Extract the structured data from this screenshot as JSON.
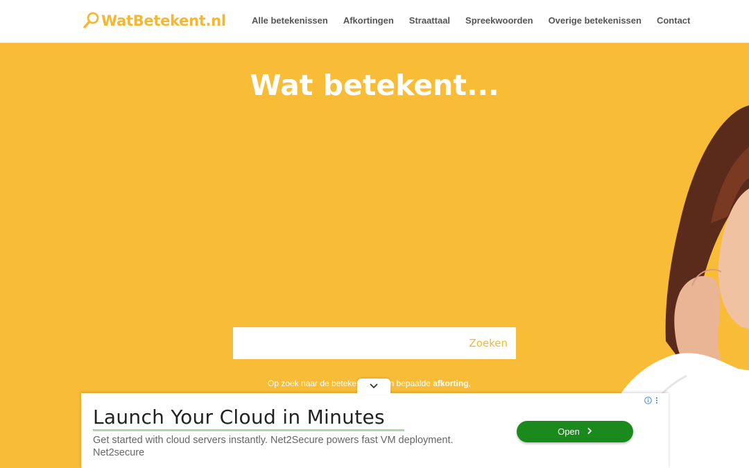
{
  "header": {
    "logo_text": "WatBetekent.nl",
    "nav": [
      {
        "label": "Alle betekenissen"
      },
      {
        "label": "Afkortingen"
      },
      {
        "label": "Straattaal"
      },
      {
        "label": "Spreekwoorden"
      },
      {
        "label": "Overige betekenissen"
      },
      {
        "label": "Contact"
      }
    ]
  },
  "hero": {
    "title": "Wat betekent...",
    "search": {
      "value": "",
      "placeholder": "",
      "button_label": "Zoeken"
    },
    "hint_prefix": "Op zoek naar de beteke",
    "hint_middle": "een bepaalde",
    "hint_bold": "afkorting",
    "hint_suffix": ","
  },
  "ad": {
    "headline": "Launch Your Cloud in Minutes",
    "description": "Get started with cloud servers instantly. Net2Secure powers fast VM deployment.",
    "advertiser": "Net2secure",
    "cta_label": "Open",
    "cta_icon": "chevron-right-icon",
    "info_icon": "info-icon",
    "menu_icon": "more-vertical-icon",
    "toggle_icon": "chevron-down-icon"
  },
  "colors": {
    "brand_yellow": "#f8bc37",
    "logo_yellow": "#f5b731",
    "cta_green": "#1b8a1d",
    "nav_text": "#555555"
  }
}
